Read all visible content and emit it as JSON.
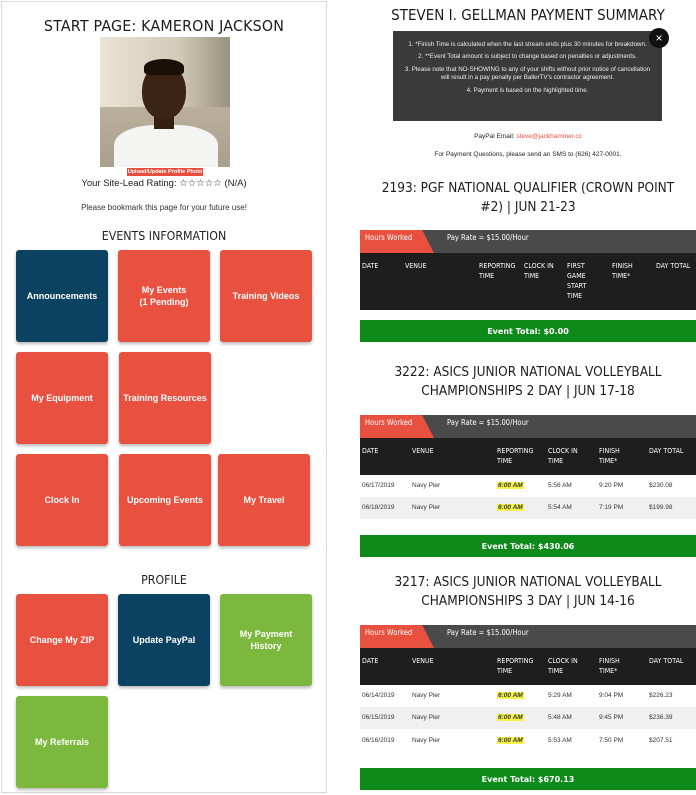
{
  "start": {
    "title": "START PAGE: KAMERON JACKSON",
    "upload_label": "Upload/Update Profile Photo",
    "rating_text": "Your Site-Lead Rating: ☆☆☆☆☆ (N/A)",
    "bookmark_text": "Please bookmark this page for your future use!",
    "events_heading": "EVENTS INFORMATION",
    "profile_heading": "PROFILE",
    "tiles": {
      "announcements": "Announcements",
      "my_events": "My Events\n(1 Pending)",
      "training_videos": "Training Videos",
      "my_equipment": "My Equipment",
      "training_resources": "Training Resources",
      "clock_in": "Clock In",
      "upcoming_events": "Upcoming Events",
      "my_travel": "My Travel",
      "change_zip": "Change My ZIP",
      "update_paypal": "Update PayPal",
      "payment_history": "My Payment History",
      "my_referrals": "My Referrals"
    },
    "colors": {
      "navy": "#0c4261",
      "red": "#e8503f",
      "green": "#7cb83d"
    }
  },
  "payment": {
    "title": "STEVEN I. GELLMAN PAYMENT SUMMARY",
    "close_icon": "×",
    "notes": [
      "1. *Finish Time is calculated when the last stream ends plus 30 minutes for breakdown.",
      "2. **Event Total amount is subject to change based on penalties or adjustments.",
      "3. Please note that NO-SHOWING to any of your shifts without prior notice of cancellation will result in a pay penalty per BallerTV's contractor agreement.",
      "4. Payment is based on the highlighted time."
    ],
    "paypal_label": "PayPal Email:",
    "paypal_email": "steve@jackhammer.cc",
    "sms_text": "For Payment Questions, please send an SMS to (626) 427-0001.",
    "hours_worked": "Hours Worked",
    "columns_a": [
      "DATE",
      "VENUE",
      "REPORTING TIME",
      "CLOCK IN TIME",
      "FIRST GAME START TIME",
      "FINISH TIME*",
      "DAY TOTAL"
    ],
    "columns_b": [
      "DATE",
      "VENUE",
      "REPORTING TIME",
      "CLOCK IN TIME",
      "FINISH TIME*",
      "DAY TOTAL"
    ],
    "events": [
      {
        "title": "2193: PGF NATIONAL QUALIFIER (CROWN POINT #2) | JUN 21-23",
        "pay_rate": "Pay Rate = $15.00/Hour",
        "rows": [],
        "total": "Event Total: $0.00"
      },
      {
        "title": "3222: ASICS JUNIOR NATIONAL VOLLEYBALL CHAMPIONSHIPS 2 DAY | JUN 17-18",
        "pay_rate": "Pay Rate = $15.00/Hour",
        "rows": [
          {
            "date": "06/17/2019",
            "venue": "Navy Pier",
            "reporting": "6:00 AM",
            "clock_in": "5:56 AM",
            "finish": "9:20 PM",
            "total": "$230.08"
          },
          {
            "date": "06/18/2019",
            "venue": "Navy Pier",
            "reporting": "6:00 AM",
            "clock_in": "5:54 AM",
            "finish": "7:19 PM",
            "total": "$199.98"
          }
        ],
        "total": "Event Total: $430.06"
      },
      {
        "title": "3217: ASICS JUNIOR NATIONAL VOLLEYBALL CHAMPIONSHIPS 3 DAY | JUN 14-16",
        "pay_rate": "Pay Rate = $15.00/Hour",
        "rows": [
          {
            "date": "06/14/2019",
            "venue": "Navy Pier",
            "reporting": "6:00 AM",
            "clock_in": "5:29 AM",
            "finish": "9:04 PM",
            "total": "$226.23"
          },
          {
            "date": "06/15/2019",
            "venue": "Navy Pier",
            "reporting": "6:00 AM",
            "clock_in": "5:48 AM",
            "finish": "9:45 PM",
            "total": "$236.39"
          },
          {
            "date": "06/16/2019",
            "venue": "Navy Pier",
            "reporting": "6:00 AM",
            "clock_in": "5:53 AM",
            "finish": "7:50 PM",
            "total": "$207.51"
          }
        ],
        "total": "Event Total: $670.13"
      }
    ],
    "colors": {
      "notice_bg": "#3a3a3a",
      "header_bg": "#1e1e1e",
      "hours_red": "#e8503f",
      "total_green": "#0e8a1b",
      "highlight": "#f6f24a"
    }
  }
}
